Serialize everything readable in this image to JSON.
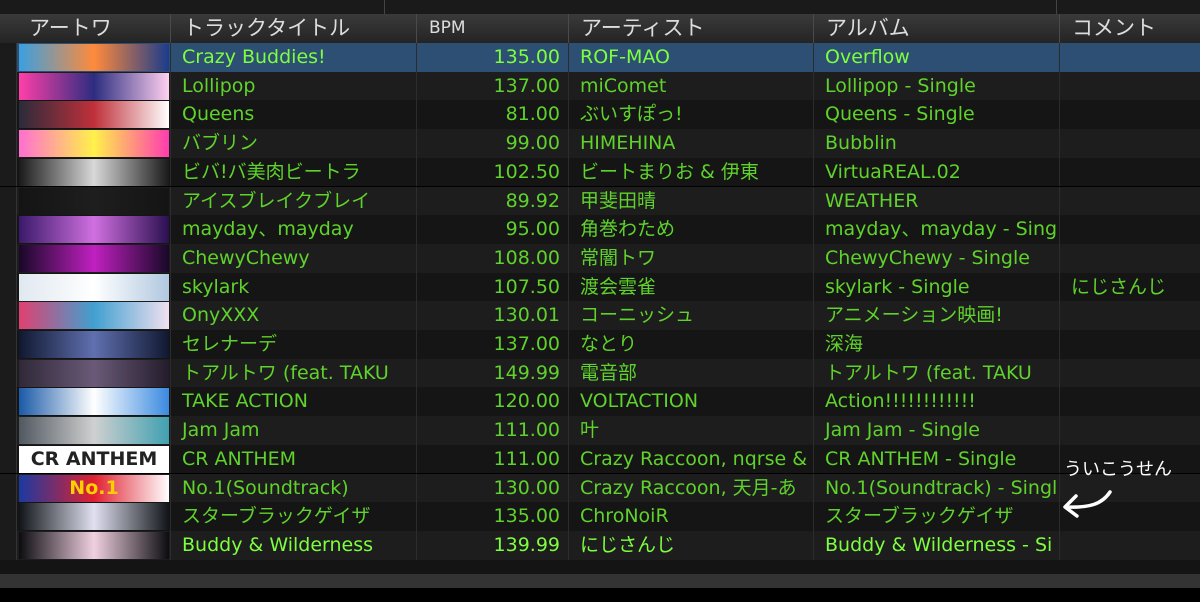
{
  "columns": {
    "artwork": "アートワ",
    "title": "トラックタイトル",
    "bpm": "BPM",
    "artist": "アーティスト",
    "album": "アルバム",
    "comment": "コメント"
  },
  "tracks": [
    {
      "title": "Crazy Buddies!",
      "bpm": "135.00",
      "artist": "ROF-MAO",
      "album": "Overflow",
      "comment": "",
      "art": [
        "#3aa0e0",
        "#ff8a3c",
        "#1b3b8c"
      ]
    },
    {
      "title": "Lollipop",
      "bpm": "137.00",
      "artist": "miComet",
      "album": "Lollipop - Single",
      "comment": "",
      "art": [
        "#ff3fa8",
        "#2d2d80",
        "#ffd0f0"
      ]
    },
    {
      "title": "Queens",
      "bpm": "81.00",
      "artist": "ぶいすぽっ!",
      "album": "Queens - Single",
      "comment": "",
      "art": [
        "#2b2b3a",
        "#c0303a",
        "#ffffff"
      ]
    },
    {
      "title": "バブリン",
      "bpm": "99.00",
      "artist": "HIMEHINA",
      "album": "Bubblin",
      "comment": "",
      "art": [
        "#ff6fd0",
        "#fff14a",
        "#ff3cb0"
      ]
    },
    {
      "title": "ビバ!バ美肉ビートラ",
      "bpm": "102.50",
      "artist": "ビートまりお & 伊東",
      "album": "VirtuaREAL.02",
      "comment": "",
      "art": [
        "#1a1a1a",
        "#d8d8d8",
        "#1a1a1a"
      ]
    },
    {
      "title": "アイスブレイクブレイ",
      "bpm": "89.92",
      "artist": "甲斐田晴",
      "album": "WEATHER",
      "comment": "",
      "art": [
        "#141414",
        "#1e1e1e",
        "#141414"
      ]
    },
    {
      "title": "mayday、mayday",
      "bpm": "95.00",
      "artist": "角巻わため",
      "album": "mayday、mayday - Sing",
      "comment": "",
      "art": [
        "#3a1a6a",
        "#d070e0",
        "#2a1050"
      ]
    },
    {
      "title": "ChewyChewy",
      "bpm": "108.00",
      "artist": "常闇トワ",
      "album": "ChewyChewy - Single",
      "comment": "",
      "art": [
        "#180828",
        "#c020c0",
        "#180828"
      ]
    },
    {
      "title": "skylark",
      "bpm": "107.50",
      "artist": "渡会雲雀",
      "album": "skylark - Single",
      "comment": "にじさんじ",
      "art": [
        "#e0e8f0",
        "#ffffff",
        "#b0c8e0"
      ]
    },
    {
      "title": "OnyXXX",
      "bpm": "130.01",
      "artist": "コーニッシュ",
      "album": "アニメーション映画!",
      "comment": "",
      "art": [
        "#e04070",
        "#40a0d0",
        "#f0e0f0"
      ]
    },
    {
      "title": "セレナーデ",
      "bpm": "137.00",
      "artist": "なとり",
      "album": "深海",
      "comment": "",
      "art": [
        "#101830",
        "#6070b0",
        "#101830"
      ]
    },
    {
      "title": "トアルトワ (feat. TAKU",
      "bpm": "149.99",
      "artist": "電音部",
      "album": "トアルトワ (feat. TAKU",
      "comment": "",
      "art": [
        "#302838",
        "#6a5a78",
        "#241c2c"
      ]
    },
    {
      "title": "TAKE ACTION",
      "bpm": "120.00",
      "artist": "VOLTACTION",
      "album": "Action!!!!!!!!!!!!",
      "comment": "",
      "art": [
        "#1a5aa8",
        "#ffffff",
        "#3a8ae0"
      ]
    },
    {
      "title": "Jam Jam",
      "bpm": "111.00",
      "artist": "叶",
      "album": "Jam Jam - Single",
      "comment": "",
      "art": [
        "#505860",
        "#d0d0d0",
        "#40a0b0"
      ]
    },
    {
      "title": "CR ANTHEM",
      "bpm": "111.00",
      "artist": "Crazy Raccoon, nqrse &",
      "album": "CR ANTHEM - Single",
      "comment": "",
      "art": [
        "#ffffff",
        "#ffffff",
        "#ffffff"
      ],
      "art_text": "CR ANTHEM"
    },
    {
      "title": "No.1(Soundtrack)",
      "bpm": "130.00",
      "artist": "Crazy Raccoon, 天月-あ",
      "album": "No.1(Soundtrack) - Singl",
      "comment": "",
      "art": [
        "#1a3aa0",
        "#e02030",
        "#ffffff"
      ],
      "art_text": "No.1"
    },
    {
      "title": "スターブラックゲイザ",
      "bpm": "135.00",
      "artist": "ChroNoiR",
      "album": "スターブラックゲイザ",
      "comment": "",
      "art": [
        "#101418",
        "#e0e0f0",
        "#101418"
      ]
    },
    {
      "title": "Buddy & Wilderness",
      "bpm": "139.99",
      "artist": "にじさんじ",
      "album": "Buddy & Wilderness - Si",
      "comment": "",
      "art": [
        "#0c0c10",
        "#f0d0e0",
        "#0c0c10"
      ]
    }
  ],
  "selected_row": 0,
  "highlight_rows": [
    0,
    17
  ],
  "colors": {
    "text": "#5fd22b",
    "selected_bg": "#2c4f73"
  },
  "annotation": {
    "text": "ういこうせん",
    "icon": "hand-drawn-arrow-icon"
  }
}
